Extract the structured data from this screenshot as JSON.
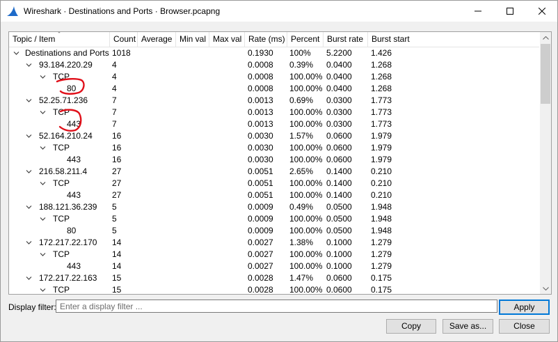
{
  "window": {
    "title": "Wireshark · Destinations and Ports · Browser.pcapng",
    "controls": {
      "minimize": "minimize-icon",
      "maximize": "maximize-icon",
      "close": "close-icon"
    }
  },
  "table": {
    "columns": [
      "Topic / Item",
      "Count",
      "Average",
      "Min val",
      "Max val",
      "Rate (ms)",
      "Percent",
      "Burst rate",
      "Burst start"
    ],
    "rows": [
      {
        "level": 0,
        "expanded": true,
        "item": "Destinations and Ports",
        "count": "1018",
        "rate": "0.1930",
        "percent": "100%",
        "burst_rate": "5.2200",
        "burst_start": "1.426"
      },
      {
        "level": 1,
        "expanded": true,
        "item": "93.184.220.29",
        "count": "4",
        "rate": "0.0008",
        "percent": "0.39%",
        "burst_rate": "0.0400",
        "burst_start": "1.268"
      },
      {
        "level": 2,
        "expanded": true,
        "item": "TCP",
        "count": "4",
        "rate": "0.0008",
        "percent": "100.00%",
        "burst_rate": "0.0400",
        "burst_start": "1.268"
      },
      {
        "level": 3,
        "item": "80",
        "count": "4",
        "rate": "0.0008",
        "percent": "100.00%",
        "burst_rate": "0.0400",
        "burst_start": "1.268",
        "circled": true
      },
      {
        "level": 1,
        "expanded": true,
        "item": "52.25.71.236",
        "count": "7",
        "rate": "0.0013",
        "percent": "0.69%",
        "burst_rate": "0.0300",
        "burst_start": "1.773"
      },
      {
        "level": 2,
        "expanded": true,
        "item": "TCP",
        "count": "7",
        "rate": "0.0013",
        "percent": "100.00%",
        "burst_rate": "0.0300",
        "burst_start": "1.773"
      },
      {
        "level": 3,
        "item": "443",
        "count": "7",
        "rate": "0.0013",
        "percent": "100.00%",
        "burst_rate": "0.0300",
        "burst_start": "1.773",
        "circled": true
      },
      {
        "level": 1,
        "expanded": true,
        "item": "52.164.210.24",
        "count": "16",
        "rate": "0.0030",
        "percent": "1.57%",
        "burst_rate": "0.0600",
        "burst_start": "1.979"
      },
      {
        "level": 2,
        "expanded": true,
        "item": "TCP",
        "count": "16",
        "rate": "0.0030",
        "percent": "100.00%",
        "burst_rate": "0.0600",
        "burst_start": "1.979"
      },
      {
        "level": 3,
        "item": "443",
        "count": "16",
        "rate": "0.0030",
        "percent": "100.00%",
        "burst_rate": "0.0600",
        "burst_start": "1.979"
      },
      {
        "level": 1,
        "expanded": true,
        "item": "216.58.211.4",
        "count": "27",
        "rate": "0.0051",
        "percent": "2.65%",
        "burst_rate": "0.1400",
        "burst_start": "0.210"
      },
      {
        "level": 2,
        "expanded": true,
        "item": "TCP",
        "count": "27",
        "rate": "0.0051",
        "percent": "100.00%",
        "burst_rate": "0.1400",
        "burst_start": "0.210"
      },
      {
        "level": 3,
        "item": "443",
        "count": "27",
        "rate": "0.0051",
        "percent": "100.00%",
        "burst_rate": "0.1400",
        "burst_start": "0.210"
      },
      {
        "level": 1,
        "expanded": true,
        "item": "188.121.36.239",
        "count": "5",
        "rate": "0.0009",
        "percent": "0.49%",
        "burst_rate": "0.0500",
        "burst_start": "1.948"
      },
      {
        "level": 2,
        "expanded": true,
        "item": "TCP",
        "count": "5",
        "rate": "0.0009",
        "percent": "100.00%",
        "burst_rate": "0.0500",
        "burst_start": "1.948"
      },
      {
        "level": 3,
        "item": "80",
        "count": "5",
        "rate": "0.0009",
        "percent": "100.00%",
        "burst_rate": "0.0500",
        "burst_start": "1.948"
      },
      {
        "level": 1,
        "expanded": true,
        "item": "172.217.22.170",
        "count": "14",
        "rate": "0.0027",
        "percent": "1.38%",
        "burst_rate": "0.1000",
        "burst_start": "1.279"
      },
      {
        "level": 2,
        "expanded": true,
        "item": "TCP",
        "count": "14",
        "rate": "0.0027",
        "percent": "100.00%",
        "burst_rate": "0.1000",
        "burst_start": "1.279"
      },
      {
        "level": 3,
        "item": "443",
        "count": "14",
        "rate": "0.0027",
        "percent": "100.00%",
        "burst_rate": "0.1000",
        "burst_start": "1.279"
      },
      {
        "level": 1,
        "expanded": true,
        "item": "172.217.22.163",
        "count": "15",
        "rate": "0.0028",
        "percent": "1.47%",
        "burst_rate": "0.0600",
        "burst_start": "0.175"
      },
      {
        "level": 2,
        "expanded": true,
        "item": "TCP",
        "count": "15",
        "rate": "0.0028",
        "percent": "100.00%",
        "burst_rate": "0.0600",
        "burst_start": "0.175"
      }
    ]
  },
  "filter": {
    "label": "Display filter:",
    "placeholder": "Enter a display filter ...",
    "value": "",
    "apply_label": "Apply"
  },
  "buttons": {
    "copy": "Copy",
    "save_as": "Save as...",
    "close": "Close"
  },
  "annotation_color": "#e0101a"
}
